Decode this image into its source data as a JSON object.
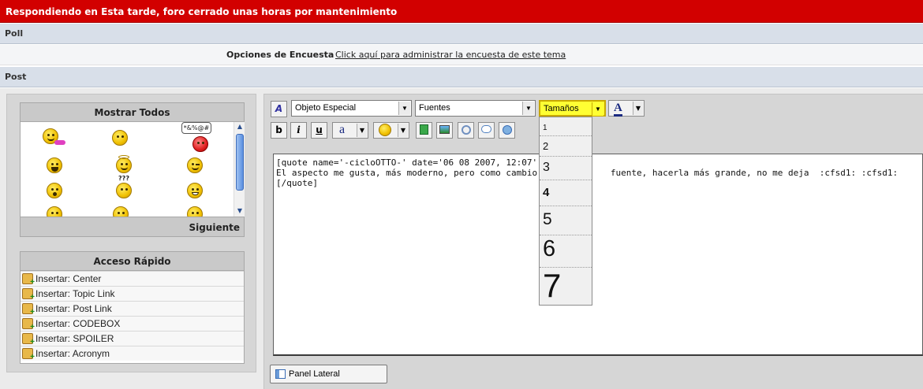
{
  "title_bar": {
    "text": "Respondiendo en Esta tarde, foro cerrado unas horas por mantenimiento"
  },
  "poll": {
    "section_label": "Poll",
    "options_label": "Opciones de Encuesta",
    "admin_link": "Click aquí para administrar la encuesta de este tema"
  },
  "post": {
    "section_label": "Post"
  },
  "smileys": {
    "header": "Mostrar Todos",
    "next_label": "Siguiente",
    "speech_text": "*&%@#",
    "confused_marks": "???"
  },
  "quick_access": {
    "header": "Acceso Rápido",
    "items": [
      "Insertar: Center",
      "Insertar: Topic Link",
      "Insertar: Post Link",
      "Insertar: CODEBOX",
      "Insertar: SPOILER",
      "Insertar: Acronym"
    ]
  },
  "toolbar": {
    "special_object": "Objeto Especial",
    "fonts": "Fuentes",
    "sizes": "Tamaños",
    "color_letter": "A",
    "bold": "b",
    "italic": "i",
    "underline": "u",
    "font_style_letter": "a"
  },
  "size_dropdown": {
    "options": [
      "1",
      "2",
      "3",
      "4",
      "5",
      "6",
      "7"
    ]
  },
  "editor": {
    "lines": [
      "[quote name='-cicloOTTO-' date='06 08 2007, 12:07' post=",
      "El aspecto me gusta, más moderno, pero como cambio el           fuente, hacerla más grande, no me deja  :cfsd1: :cfsd1:",
      "[/quote]"
    ]
  },
  "side_panel": {
    "label": "Panel Lateral"
  },
  "colors": {
    "title_bar_bg": "#d20000",
    "section_bar_bg": "#d8dfe9",
    "sizes_highlight": "#ffff33",
    "scroll_thumb": "#5a8fe0"
  }
}
